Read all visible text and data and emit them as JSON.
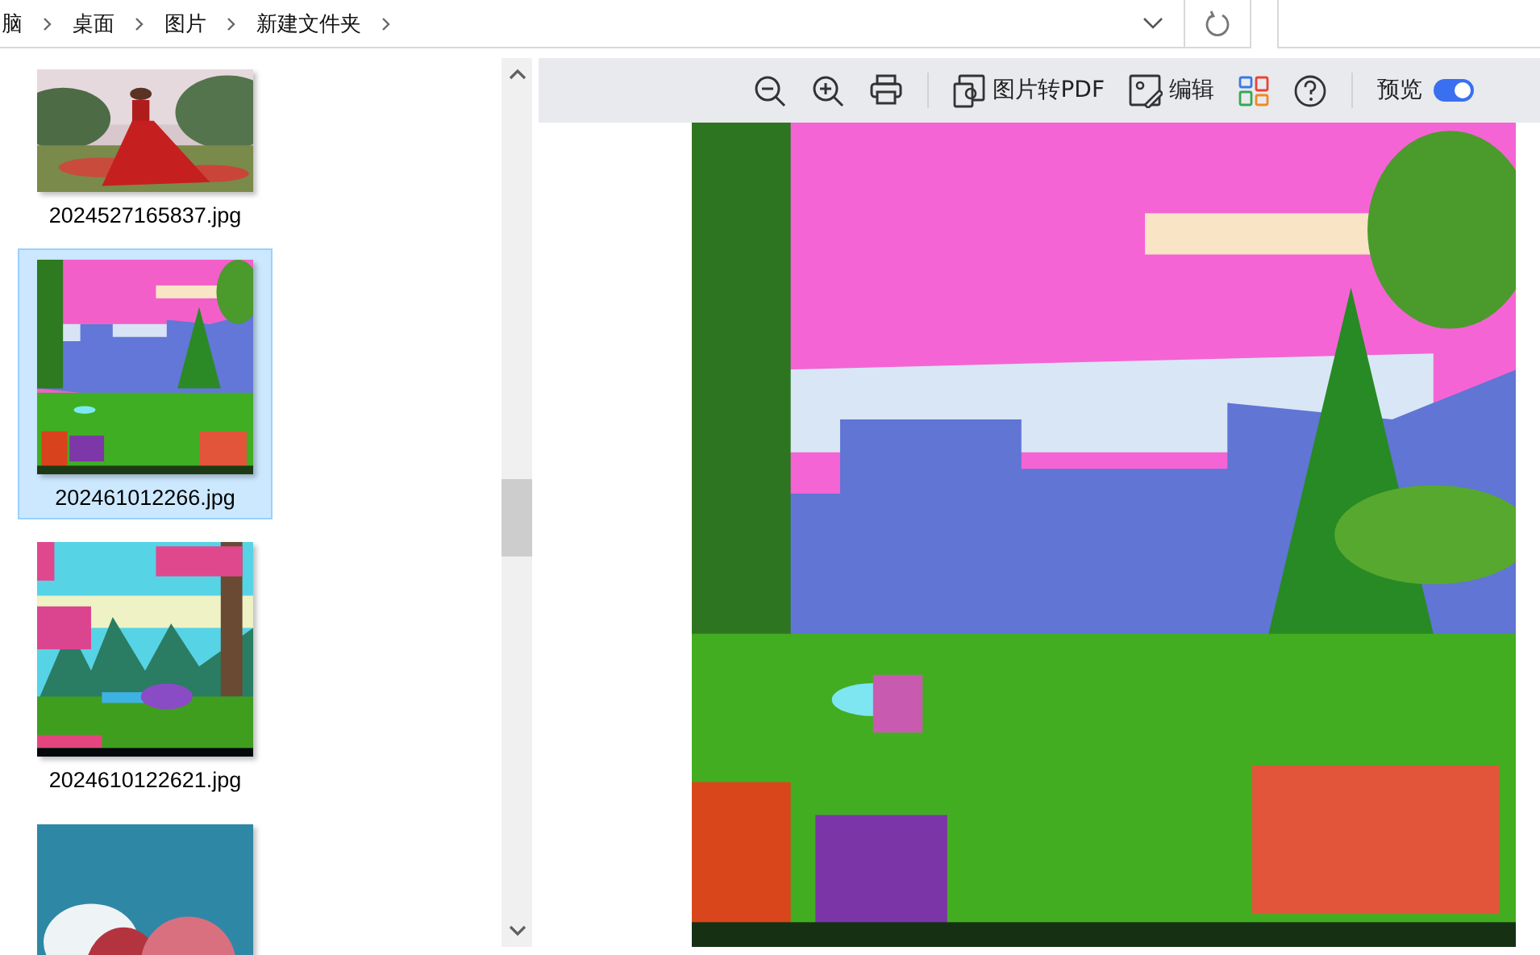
{
  "breadcrumb": [
    "脑",
    "桌面",
    "图片",
    "新建文件夹"
  ],
  "files": [
    {
      "name": "2024527165837.jpg",
      "selected": false
    },
    {
      "name": "202461012266.jpg",
      "selected": true
    },
    {
      "name": "2024610122621.jpg",
      "selected": false
    },
    {
      "selected": false
    }
  ],
  "preview_toolbar": [
    {
      "kind": "zoom-out"
    },
    {
      "kind": "zoom-in"
    },
    {
      "kind": "print"
    },
    {
      "kind": "divider"
    },
    {
      "kind": "pdf",
      "label": "图片转PDF"
    },
    {
      "kind": "edit",
      "label": "编辑"
    },
    {
      "kind": "apps"
    },
    {
      "kind": "help"
    },
    {
      "kind": "divider"
    },
    {
      "kind": "toggle",
      "label": "预览",
      "on": true
    }
  ]
}
